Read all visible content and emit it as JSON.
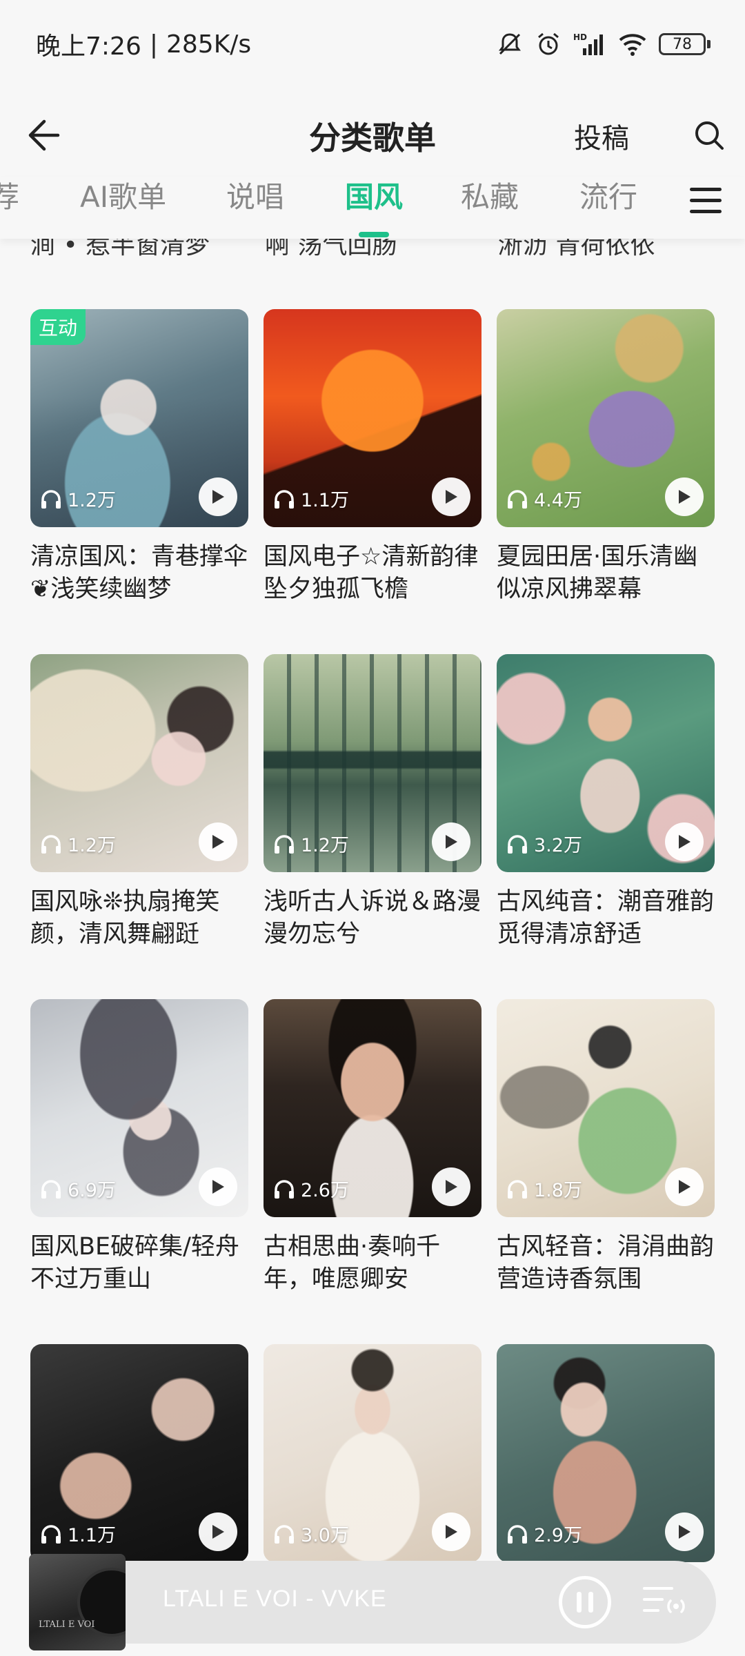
{
  "status_bar": {
    "time": "晚上7:26",
    "net_speed": "285K/s",
    "separator": "|",
    "battery": "78",
    "hd_label": "HD"
  },
  "header": {
    "title": "分类歌单",
    "submit_label": "投稿",
    "back_icon": "back-arrow-icon",
    "search_icon": "search-icon"
  },
  "tabs": {
    "items": [
      {
        "label": "荐"
      },
      {
        "label": "AI歌单"
      },
      {
        "label": "说唱"
      },
      {
        "label": "国风",
        "active": true
      },
      {
        "label": "私藏"
      },
      {
        "label": "流行"
      }
    ],
    "menu_icon": "menu-icon"
  },
  "partial_row": [
    "涧 • 惹半窗清梦",
    "啊 荡气回肠",
    "淅沥 青荷依依"
  ],
  "playlists": [
    {
      "title": "清凉国风：青巷撑伞❦浅笑续幽梦",
      "count": "1.2万",
      "badge": "互动"
    },
    {
      "title": "国风电子☆清新韵律坠夕独孤飞檐",
      "count": "1.1万"
    },
    {
      "title": "夏园田居·国乐清幽似凉风拂翠幕",
      "count": "4.4万"
    },
    {
      "title": "国风咏❊执扇掩笑颜，清风舞翩跹",
      "count": "1.2万"
    },
    {
      "title": "浅听古人诉说＆路漫漫勿忘兮",
      "count": "1.2万"
    },
    {
      "title": "古风纯音：潮音雅韵觅得清凉舒适",
      "count": "3.2万"
    },
    {
      "title": "国风BE破碎集/轻舟不过万重山",
      "count": "6.9万"
    },
    {
      "title": "古相思曲·奏响千年，唯愿卿安",
      "count": "2.6万"
    },
    {
      "title": "古风轻音：涓涓曲韵营造诗香氛围",
      "count": "1.8万"
    },
    {
      "title": "",
      "count": "1.1万"
    },
    {
      "title": "",
      "count": "3.0万"
    },
    {
      "title": "",
      "count": "2.9万"
    }
  ],
  "mini_player": {
    "song": "LTALI E VOI - VVKE",
    "art_text": "LTALI E VOI"
  },
  "colors": {
    "accent": "#1ec08a",
    "badge": "#2fd38f"
  }
}
